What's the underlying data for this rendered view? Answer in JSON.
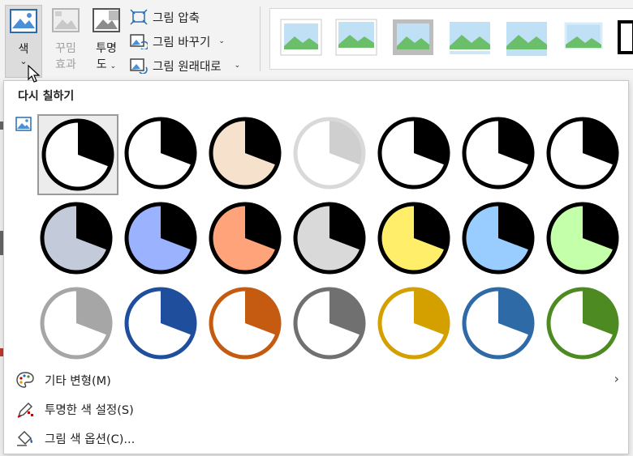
{
  "ribbon": {
    "color_btn": {
      "label1": "색",
      "caret": "⌄"
    },
    "effects_btn": {
      "label1": "꾸밈",
      "label2": "효과"
    },
    "transparency_btn": {
      "label1": "투명",
      "label2": "도"
    },
    "compress_label": "그림 압축",
    "change_label": "그림 바꾸기",
    "reset_label": "그림 원래대로",
    "caret_small": "⌄"
  },
  "panel": {
    "title": "다시 칠하기",
    "swatches": [
      {
        "fill": "#ffffff",
        "slice": "#000000",
        "ring": "#000000"
      },
      {
        "fill": "#ffffff",
        "slice": "#000000",
        "ring": "#000000"
      },
      {
        "fill": "#f5e1cc",
        "slice": "#000000",
        "ring": "#000000"
      },
      {
        "fill": "#ffffff",
        "slice": "#cfcfcf",
        "ring": "#d9d9d9"
      },
      {
        "fill": "#ffffff",
        "slice": "#000000",
        "ring": "#000000"
      },
      {
        "fill": "#ffffff",
        "slice": "#000000",
        "ring": "#000000"
      },
      {
        "fill": "#ffffff",
        "slice": "#000000",
        "ring": "#000000"
      },
      {
        "fill": "#c3cad9",
        "slice": "#000000",
        "ring": "#000000"
      },
      {
        "fill": "#9bb3ff",
        "slice": "#000000",
        "ring": "#000000"
      },
      {
        "fill": "#ffa37a",
        "slice": "#000000",
        "ring": "#000000"
      },
      {
        "fill": "#d9d9d9",
        "slice": "#000000",
        "ring": "#000000"
      },
      {
        "fill": "#ffee6a",
        "slice": "#000000",
        "ring": "#000000"
      },
      {
        "fill": "#99ccff",
        "slice": "#000000",
        "ring": "#000000"
      },
      {
        "fill": "#c4ffaa",
        "slice": "#000000",
        "ring": "#000000"
      },
      {
        "fill": "#ffffff",
        "slice": "#a6a6a6",
        "ring": "#a6a6a6"
      },
      {
        "fill": "#ffffff",
        "slice": "#1f4e9c",
        "ring": "#1f4e9c"
      },
      {
        "fill": "#ffffff",
        "slice": "#c55a11",
        "ring": "#c55a11"
      },
      {
        "fill": "#ffffff",
        "slice": "#707070",
        "ring": "#707070"
      },
      {
        "fill": "#ffffff",
        "slice": "#d4a000",
        "ring": "#d4a000"
      },
      {
        "fill": "#ffffff",
        "slice": "#2e6aa6",
        "ring": "#2e6aa6"
      },
      {
        "fill": "#ffffff",
        "slice": "#4e8a22",
        "ring": "#4e8a22"
      }
    ],
    "menu": {
      "more_variations": "기타 변형(M)",
      "set_transparent": "투명한 색 설정(S)",
      "color_options": "그림 색 옵션(C)..."
    },
    "more_arrow": "›"
  }
}
